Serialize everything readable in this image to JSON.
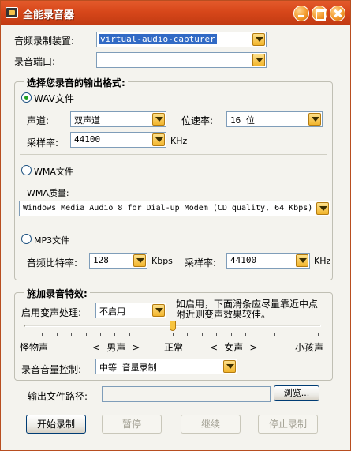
{
  "window": {
    "title": "全能录音器"
  },
  "device": {
    "label": "音频录制装置:",
    "value": "virtual-audio-capturer"
  },
  "port": {
    "label": "录音端口:",
    "value": ""
  },
  "format_group": {
    "title": "选择您录音的输出格式:",
    "wav": {
      "label": "WAV文件",
      "channel_label": "声道:",
      "channel_value": "双声道",
      "bitrate_label": "位速率:",
      "bitrate_value": "16 位",
      "sample_label": "采样率:",
      "sample_value": "44100",
      "sample_unit": "KHz"
    },
    "wma": {
      "label": "WMA文件",
      "quality_label": "WMA质量:",
      "quality_value": "Windows Media Audio 8 for Dial-up Modem (CD quality, 64 Kbps)"
    },
    "mp3": {
      "label": "MP3文件",
      "bitrate_label": "音频比特率:",
      "bitrate_value": "128",
      "bitrate_unit": "Kbps",
      "sample_label": "采样率:",
      "sample_value": "44100",
      "sample_unit": "KHz"
    }
  },
  "effects_group": {
    "title": "施加录音特效:",
    "voice_label": "启用变声处理:",
    "voice_value": "不启用",
    "hint_line1": "如启用，下面滑条应尽量靠近中点",
    "hint_line2": "附近则变声效果较佳。",
    "slider_value": 0.5,
    "scale": {
      "monster": "怪物声",
      "male": "<- 男声 ->",
      "normal": "正常",
      "female": "<- 女声 ->",
      "child": "小孩声"
    },
    "volume_label": "录音音量控制:",
    "volume_value": "中等 音量录制"
  },
  "output": {
    "label": "输出文件路径:",
    "value": "",
    "browse": "浏览..."
  },
  "buttons": {
    "start": "开始录制",
    "pause": "暂停",
    "resume": "继续",
    "stop": "停止录制"
  },
  "colors": {
    "title_bar": "#d7471a",
    "accent_button": "#f2b52d",
    "selection": "#316ac5"
  }
}
